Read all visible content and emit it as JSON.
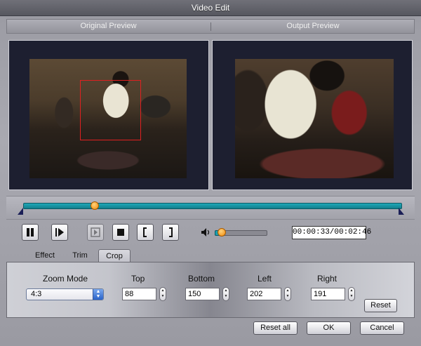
{
  "window": {
    "title": "Video Edit"
  },
  "preview": {
    "original_label": "Original Preview",
    "output_label": "Output Preview"
  },
  "timeline": {
    "position": 0.19
  },
  "controls": {
    "buttons": [
      "pause-icon",
      "step-forward-icon",
      "next-frame-icon",
      "stop-icon",
      "mark-in-icon",
      "mark-out-icon"
    ],
    "volume": 0.14,
    "timecode": "00:00:33/00:02:46"
  },
  "tabs": [
    {
      "label": "Effect"
    },
    {
      "label": "Trim"
    },
    {
      "label": "Crop",
      "active": true
    }
  ],
  "crop": {
    "zoom_mode_label": "Zoom Mode",
    "zoom_mode_value": "4:3",
    "top_label": "Top",
    "top_value": "88",
    "bottom_label": "Bottom",
    "bottom_value": "150",
    "left_label": "Left",
    "left_value": "202",
    "right_label": "Right",
    "right_value": "191",
    "reset_label": "Reset"
  },
  "footer": {
    "reset_all_label": "Reset all",
    "ok_label": "OK",
    "cancel_label": "Cancel"
  },
  "colors": {
    "accent": "#1fa8b8",
    "knob": "#f08a0c",
    "crop_rect": "#e02020",
    "preview_bg": "#1d1f30"
  }
}
